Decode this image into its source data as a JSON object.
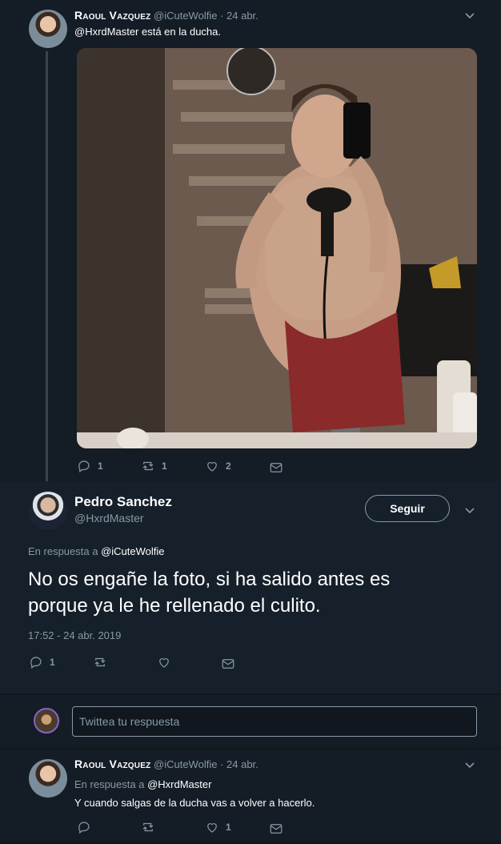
{
  "tweet1": {
    "display_name": "Raoul Vazquez",
    "handle": "@iCuteWolfie",
    "date": "· 24 abr.",
    "mention": "@HxrdMaster",
    "text": " está en la ducha.",
    "replies": "1",
    "retweets": "1",
    "likes": "2"
  },
  "main_tweet": {
    "display_name": "Pedro Sanchez",
    "handle": "@HxrdMaster",
    "follow_label": "Seguir",
    "reply_prefix": "En respuesta a ",
    "reply_to": "@iCuteWolfie",
    "text_line1": "No os engañe la foto, si ha salido antes es",
    "text_line2": "porque ya le he rellenado el culito.",
    "timestamp": "17:52 - 24 abr. 2019",
    "replies": "1"
  },
  "reply_box": {
    "placeholder": "Twittea tu respuesta"
  },
  "tweet3": {
    "display_name": "Raoul Vazquez",
    "handle": "@iCuteWolfie",
    "date": "· 24 abr.",
    "reply_prefix": "En respuesta a ",
    "reply_to": "@HxrdMaster",
    "text": "Y cuando salgas de la ducha vas a volver a hacerlo.",
    "likes": "1"
  },
  "colors": {
    "background": "#141d26",
    "main_tweet_bg": "#15202b",
    "muted": "#8899a6",
    "text": "#ffffff"
  }
}
